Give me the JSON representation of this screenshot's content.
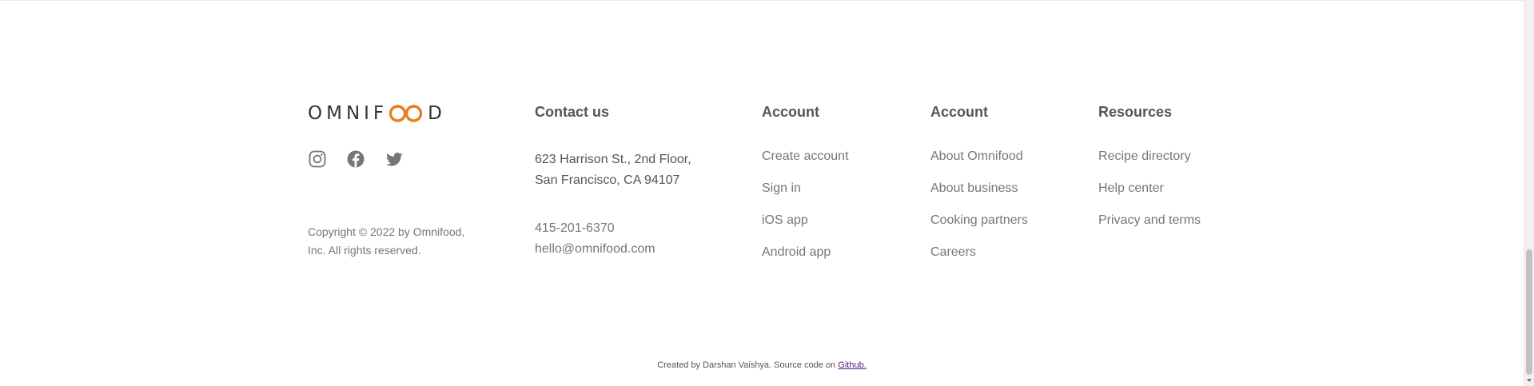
{
  "footer": {
    "logo": {
      "text_before": "OMNIF",
      "text_after": "D",
      "accent_color": "#e67e22",
      "icon": "infinity-oo-icon"
    },
    "social": [
      {
        "name": "instagram",
        "icon": "instagram-icon"
      },
      {
        "name": "facebook",
        "icon": "facebook-icon"
      },
      {
        "name": "twitter",
        "icon": "twitter-icon"
      }
    ],
    "copyright_lines": [
      "Copyright © 2022 by Omnifood,",
      "Inc. All rights reserved."
    ],
    "contact": {
      "title": "Contact us",
      "address_lines": [
        "623 Harrison St., 2nd Floor,",
        "San Francisco, CA 94107"
      ],
      "phone": "415-201-6370",
      "email": "hello@omnifood.com"
    },
    "columns": [
      {
        "title": "Account",
        "links": [
          "Create account",
          "Sign in",
          "iOS app",
          "Android app"
        ]
      },
      {
        "title": "Account",
        "links": [
          "About Omnifood",
          "About business",
          "Cooking partners",
          "Careers"
        ]
      },
      {
        "title": "Resources",
        "links": [
          "Recipe directory",
          "Help center",
          "Privacy and terms"
        ]
      }
    ]
  },
  "credit": {
    "text": "Created by Darshan Vaishya. Source code on ",
    "link_label": "Github."
  },
  "colors": {
    "text_dark": "#555555",
    "text_muted": "#767676",
    "link_visited": "#551a8b"
  }
}
